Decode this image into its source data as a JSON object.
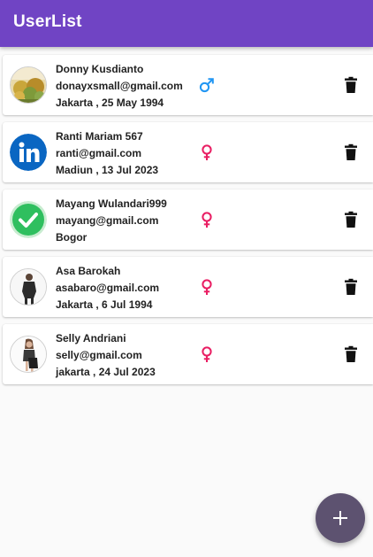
{
  "appbar": {
    "title": "UserList",
    "color": "#7044c4"
  },
  "users": [
    {
      "name": "Donny Kusdianto",
      "email": "donayxsmall@gmail.com",
      "location_date": "Jakarta , 25 May 1994",
      "gender": "male",
      "gender_icon": "male-symbol-icon",
      "avatar": "photo-icon"
    },
    {
      "name": "Ranti Mariam 567",
      "email": "ranti@gmail.com",
      "location_date": "Madiun , 13 Jul 2023",
      "gender": "female",
      "gender_icon": "female-symbol-icon",
      "avatar": "linkedin-logo-icon"
    },
    {
      "name": "Mayang Wulandari999",
      "email": "mayang@gmail.com",
      "location_date": "Bogor",
      "gender": "female",
      "gender_icon": "female-symbol-icon",
      "avatar": "green-check-icon"
    },
    {
      "name": "Asa Barokah",
      "email": "asabaro@gmail.com",
      "location_date": "Jakarta , 6 Jul 1994",
      "gender": "female",
      "gender_icon": "female-symbol-icon",
      "avatar": "person-photo-icon"
    },
    {
      "name": "Selly Andriani",
      "email": "selly@gmail.com",
      "location_date": "jakarta , 24 Jul 2023",
      "gender": "female",
      "gender_icon": "female-symbol-icon",
      "avatar": "person-photo-icon"
    }
  ],
  "colors": {
    "male": "#2196f3",
    "female": "#e91e63",
    "fab": "#5d5270",
    "delete": "#111111"
  },
  "fab": {
    "icon": "plus-icon"
  }
}
